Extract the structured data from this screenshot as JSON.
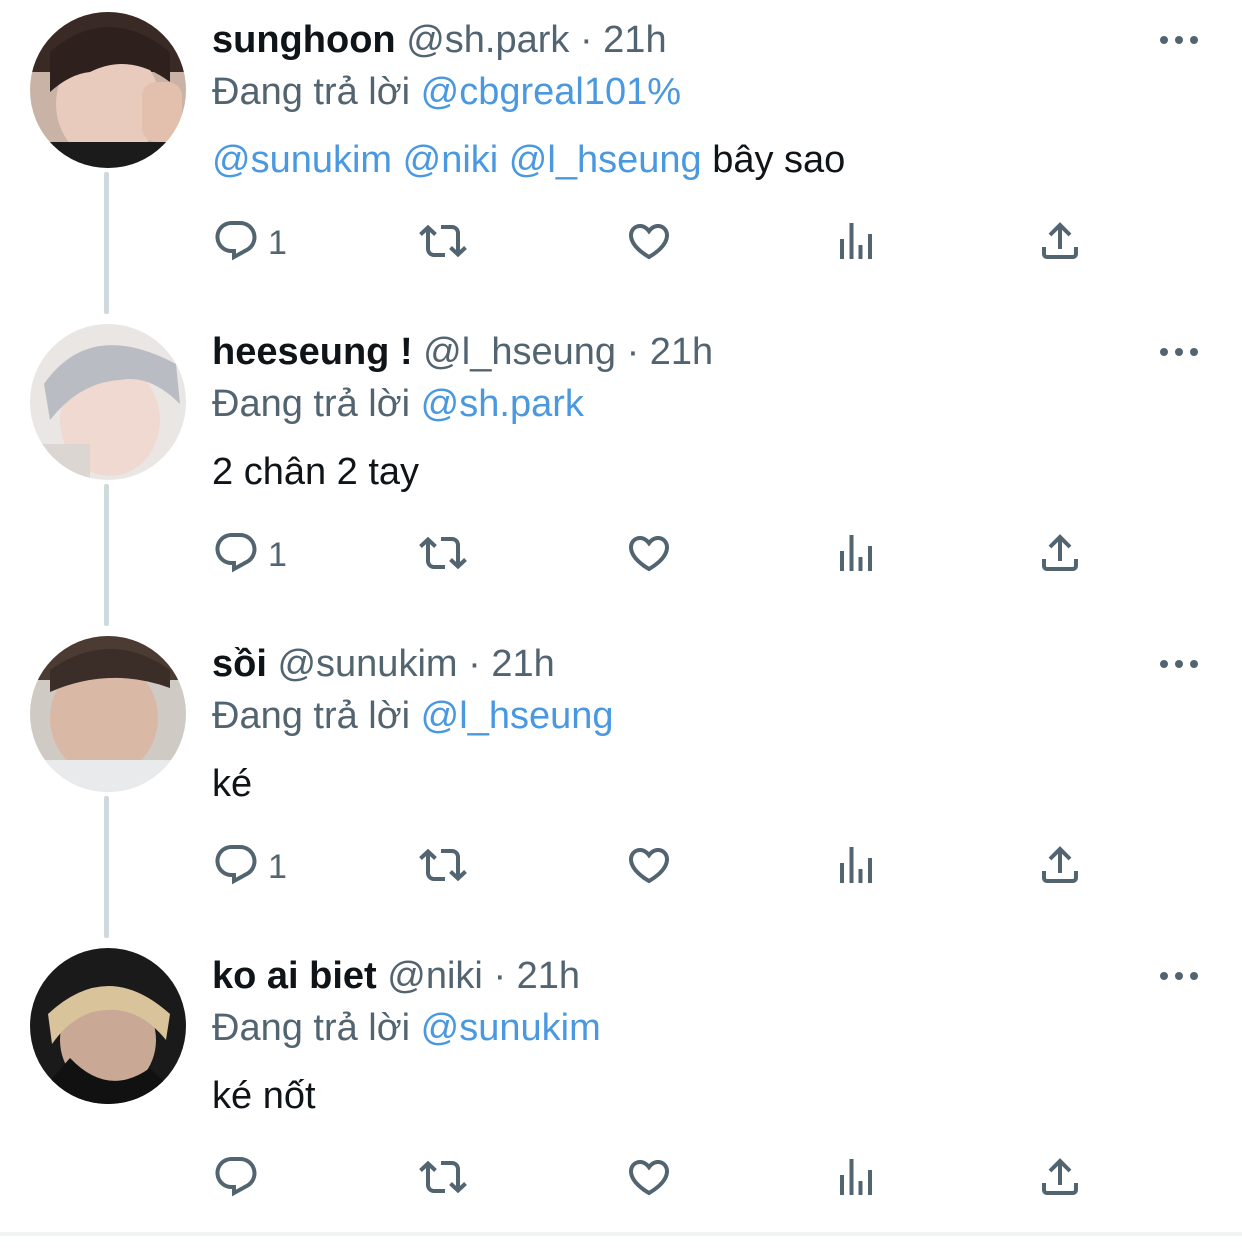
{
  "colors": {
    "link": "#4a99e0",
    "secondary": "#536471",
    "text": "#0f1419",
    "thread_line": "#cfd9de"
  },
  "replying_prefix": "Đang trả lời",
  "tweets": [
    {
      "name": "sunghoon",
      "handle": "@sh.park",
      "separator": "·",
      "time": "21h",
      "replying_to": "@cbgreal101%",
      "mentions": [
        "@sunukim",
        "@niki",
        "@l_hseung"
      ],
      "text": "bây sao",
      "reply_count": "1",
      "avatar_icon": "avatar-photo"
    },
    {
      "name": "heeseung !",
      "handle": "@l_hseung",
      "separator": "·",
      "time": "21h",
      "replying_to": "@sh.park",
      "text": "2 chân 2 tay",
      "reply_count": "1",
      "avatar_icon": "avatar-photo"
    },
    {
      "name": "sồi",
      "handle": "@sunukim",
      "separator": "·",
      "time": "21h",
      "replying_to": "@l_hseung",
      "text": "ké",
      "reply_count": "1",
      "avatar_icon": "avatar-photo"
    },
    {
      "name": "ko ai biet",
      "handle": "@niki",
      "separator": "·",
      "time": "21h",
      "replying_to": "@sunukim",
      "text": "ké nốt",
      "reply_count": "",
      "avatar_icon": "avatar-photo"
    }
  ],
  "icons": {
    "reply": "reply-icon",
    "retweet": "retweet-icon",
    "like": "heart-icon",
    "views": "views-icon",
    "share": "share-icon",
    "more": "more-icon"
  }
}
